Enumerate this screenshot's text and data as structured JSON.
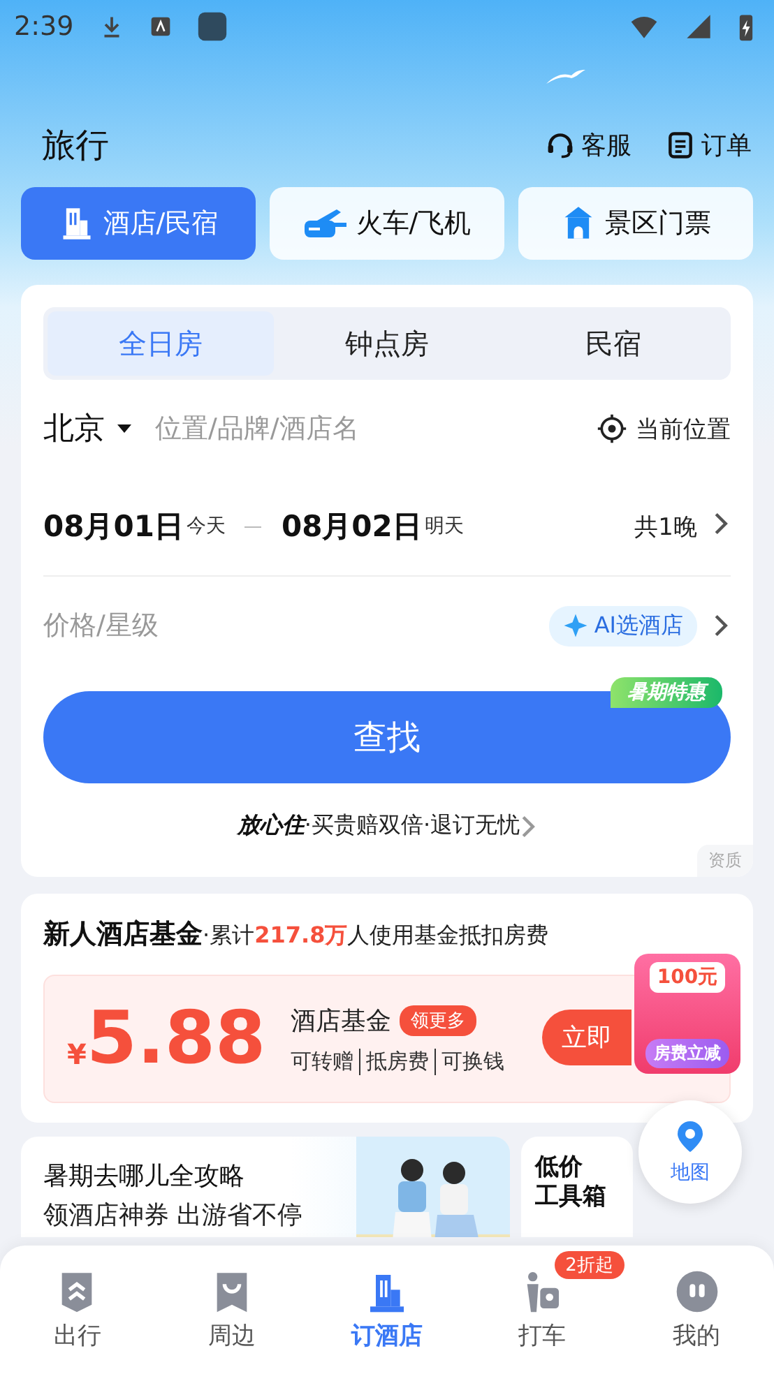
{
  "status_bar": {
    "time": "2:39"
  },
  "header": {
    "title": "旅行",
    "actions": [
      {
        "label": "客服"
      },
      {
        "label": "订单"
      }
    ]
  },
  "categories": [
    {
      "label": "酒店/民宿",
      "selected": true
    },
    {
      "label": "火车/飞机",
      "selected": false
    },
    {
      "label": "景区门票",
      "selected": false
    }
  ],
  "booking": {
    "room_types": [
      {
        "label": "全日房",
        "selected": true
      },
      {
        "label": "钟点房",
        "selected": false
      },
      {
        "label": "民宿",
        "selected": false
      }
    ],
    "city": "北京",
    "search_placeholder": "位置/品牌/酒店名",
    "locate_label": "当前位置",
    "check_in": {
      "date": "08月01日",
      "day": "今天"
    },
    "check_out": {
      "date": "08月02日",
      "day": "明天"
    },
    "nights": "共1晚",
    "price_placeholder": "价格/星级",
    "ai_button": "AI选酒店",
    "search_button": "查找",
    "promo_badge": "暑期特惠",
    "guarantee": {
      "brand": "放心住",
      "text": "·买贵赔双倍·退订无忧"
    },
    "license_tag": "资质"
  },
  "fund": {
    "title": "新人酒店基金",
    "subtitle": "·累计**217.8万**人使用基金抵扣房费",
    "currency": "¥",
    "amount": "5.88",
    "name": "酒店基金",
    "more_badge": "领更多",
    "features": [
      "可转赠",
      "抵房费",
      "可换钱"
    ],
    "claim_button": "立即",
    "sticker": {
      "amount": "100元",
      "label": "房费立减"
    }
  },
  "promos": [
    {
      "kind": "guide",
      "title": "暑期去哪儿全攻略",
      "subtitle": "领酒店神券 出游省不停"
    },
    {
      "kind": "toolbox",
      "title_lines": [
        "低价",
        "工具箱"
      ]
    }
  ],
  "map_button": {
    "label": "地图"
  },
  "nav": [
    {
      "label": "出行",
      "selected": false
    },
    {
      "label": "周边",
      "selected": false
    },
    {
      "label": "订酒店",
      "selected": true
    },
    {
      "label": "打车",
      "selected": false,
      "badge": "2折起"
    },
    {
      "label": "我的",
      "selected": false
    }
  ]
}
